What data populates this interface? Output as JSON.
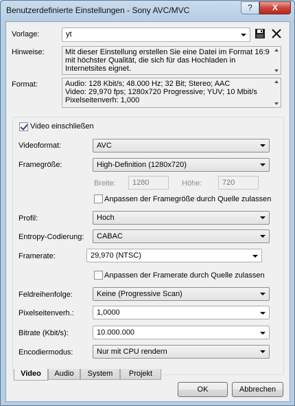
{
  "window": {
    "title": "Benutzerdefinierte Einstellungen - Sony AVC/MVC",
    "help_glyph": "?",
    "close_glyph": "X"
  },
  "template": {
    "label": "Vorlage:",
    "value": "yt"
  },
  "notes": {
    "label": "Hinweise:",
    "text": "Mit dieser Einstellung erstellen Sie eine Datei im Format 16:9 mit höchster Qualität, die sich für das Hochladen in Internetsites eignet."
  },
  "format": {
    "label": "Format:",
    "line1": "Audio: 128 Kbit/s; 48.000 Hz; 32 Bit; Stereo; AAC",
    "line2": "Video: 29,970 fps; 1280x720 Progressive; YUV; 10 Mbit/s",
    "line3": "Pixelseitenverh: 1,000"
  },
  "video": {
    "include_label": "Video einschließen",
    "include_checked": true,
    "format_label": "Videoformat:",
    "format_value": "AVC",
    "framesize_label": "Framegröße:",
    "framesize_value": "High-Definition (1280x720)",
    "width_label": "Breite:",
    "width_value": "1280",
    "height_label": "Höhe:",
    "height_value": "720",
    "adapt_size_label": "Anpassen der Framegröße durch Quelle zulassen",
    "profile_label": "Profil:",
    "profile_value": "Hoch",
    "entropy_label": "Entropy-Codierung:",
    "entropy_value": "CABAC",
    "framerate_label": "Framerate:",
    "framerate_value": "29,970 (NTSC)",
    "adapt_rate_label": "Anpassen der Framerate durch Quelle zulassen",
    "field_order_label": "Feldreihenfolge:",
    "field_order_value": "Keine (Progressive Scan)",
    "pixel_aspect_label": "Pixelseitenverh.:",
    "pixel_aspect_value": "1,0000",
    "bitrate_label": "Bitrate (Kbit/s):",
    "bitrate_value": "10.000.000",
    "encode_mode_label": "Encodiermodus:",
    "encode_mode_value": "Nur mit CPU rendern"
  },
  "tabs": [
    {
      "label": "Video",
      "active": true
    },
    {
      "label": "Audio",
      "active": false
    },
    {
      "label": "System",
      "active": false
    },
    {
      "label": "Projekt",
      "active": false
    }
  ],
  "buttons": {
    "ok": "OK",
    "cancel": "Abbrechen"
  }
}
